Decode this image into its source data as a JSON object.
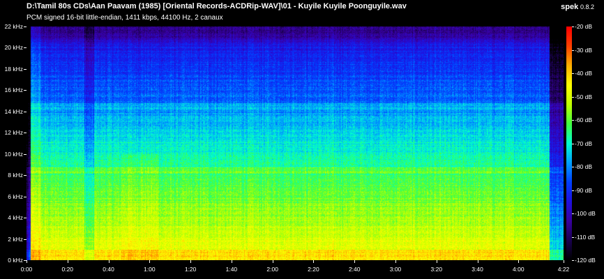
{
  "header": {
    "file_path": "D:\\Tamil 80s CDs\\Aan Paavam (1985) [Oriental Records-ACDRip-WAV]\\01 - Kuyile Kuyile Poonguyile.wav",
    "file_info": "PCM signed 16-bit little-endian, 1411 kbps, 44100 Hz, 2 canaux",
    "app_name": "spek",
    "app_version": "0.8.2"
  },
  "chart_data": {
    "type": "heatmap",
    "x_ticks": [
      "0:00",
      "0:20",
      "0:40",
      "1:00",
      "1:20",
      "1:40",
      "2:00",
      "2:20",
      "2:40",
      "3:00",
      "3:20",
      "3:40",
      "4:00",
      "4:22"
    ],
    "x_tick_seconds": [
      0,
      20,
      40,
      60,
      80,
      100,
      120,
      140,
      160,
      180,
      200,
      220,
      240,
      262
    ],
    "x_range_seconds": [
      0,
      262
    ],
    "y_ticks": [
      "0 kHz",
      "2 kHz",
      "4 kHz",
      "6 kHz",
      "8 kHz",
      "10 kHz",
      "12 kHz",
      "14 kHz",
      "16 kHz",
      "18 kHz",
      "20 kHz",
      "22 kHz"
    ],
    "y_tick_khz": [
      0,
      2,
      4,
      6,
      8,
      10,
      12,
      14,
      16,
      18,
      20,
      22
    ],
    "y_range_khz": [
      0,
      22
    ],
    "db_ticks": [
      "-20 dB",
      "-30 dB",
      "-40 dB",
      "-50 dB",
      "-60 dB",
      "-70 dB",
      "-80 dB",
      "-90 dB",
      "-100 dB",
      "-110 dB",
      "-120 dB"
    ],
    "db_tick_values": [
      -20,
      -30,
      -40,
      -50,
      -60,
      -70,
      -80,
      -90,
      -100,
      -110,
      -120
    ],
    "db_range": [
      -120,
      -20
    ],
    "colormap": [
      "#000000",
      "#1a0050",
      "#3a00a0",
      "#2010e0",
      "#0040ff",
      "#00a0ff",
      "#00ffd0",
      "#40ff40",
      "#c0ff00",
      "#ffff00",
      "#ffb000",
      "#ff4000",
      "#ff0000"
    ]
  }
}
